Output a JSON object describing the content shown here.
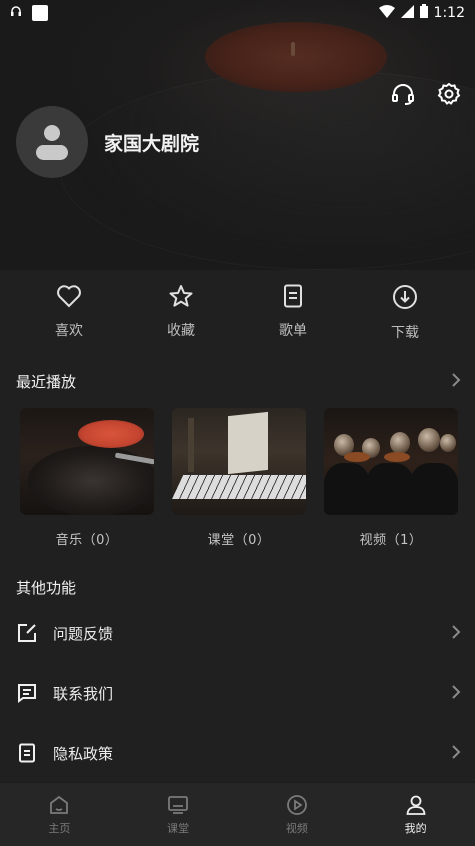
{
  "status_bar": {
    "time": "1:12"
  },
  "profile": {
    "name": "家国大剧院"
  },
  "quick_actions": [
    {
      "label": "喜欢",
      "icon": "heart-icon"
    },
    {
      "label": "收藏",
      "icon": "star-icon"
    },
    {
      "label": "歌单",
      "icon": "playlist-icon"
    },
    {
      "label": "下载",
      "icon": "download-icon"
    }
  ],
  "recent": {
    "title": "最近播放",
    "items": [
      {
        "label": "音乐（0）"
      },
      {
        "label": "课堂（0）"
      },
      {
        "label": "视频（1）"
      }
    ]
  },
  "other": {
    "title": "其他功能",
    "items": [
      {
        "label": "问题反馈",
        "icon": "feedback-icon"
      },
      {
        "label": "联系我们",
        "icon": "message-icon"
      },
      {
        "label": "隐私政策",
        "icon": "document-icon"
      }
    ]
  },
  "nav": {
    "tabs": [
      {
        "label": "主页",
        "icon": "home-icon"
      },
      {
        "label": "课堂",
        "icon": "classroom-icon"
      },
      {
        "label": "视频",
        "icon": "video-icon"
      },
      {
        "label": "我的",
        "icon": "user-icon"
      }
    ],
    "active_index": 3
  },
  "colors": {
    "background": "#202020",
    "nav_bg": "#262626",
    "text": "#e8e8e8",
    "muted": "#bdbdbd"
  }
}
